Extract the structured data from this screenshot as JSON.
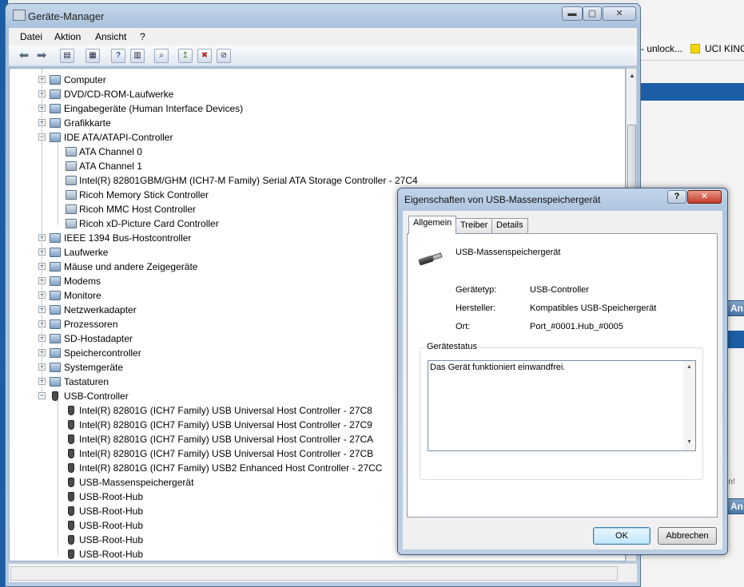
{
  "background": {
    "tab_left": "- unlock...",
    "tab_right": "UCI KINO",
    "btn_label": "An",
    "side_text": "en!"
  },
  "window": {
    "title": "Geräte-Manager",
    "minimize": "▬",
    "maximize": "▢",
    "close": "✕"
  },
  "menu": [
    "Datei",
    "Aktion",
    "Ansicht",
    "?"
  ],
  "tree": [
    {
      "label": "Computer",
      "level": 1,
      "exp": "+",
      "icon": "computer-icon"
    },
    {
      "label": "DVD/CD-ROM-Laufwerke",
      "level": 1,
      "exp": "+",
      "icon": "disc-drive-icon"
    },
    {
      "label": "Eingabegeräte (Human Interface Devices)",
      "level": 1,
      "exp": "+",
      "icon": "hid-icon"
    },
    {
      "label": "Grafikkarte",
      "level": 1,
      "exp": "+",
      "icon": "display-adapter-icon"
    },
    {
      "label": "IDE ATA/ATAPI-Controller",
      "level": 1,
      "exp": "−",
      "icon": "ide-controller-icon"
    },
    {
      "label": "ATA Channel 0",
      "level": 2,
      "icon": "ide-channel-icon"
    },
    {
      "label": "ATA Channel 1",
      "level": 2,
      "icon": "ide-channel-icon"
    },
    {
      "label": "Intel(R) 82801GBM/GHM (ICH7-M Family) Serial ATA Storage Controller - 27C4",
      "level": 2,
      "icon": "ide-channel-icon"
    },
    {
      "label": "Ricoh Memory Stick Controller",
      "level": 2,
      "icon": "ide-channel-icon"
    },
    {
      "label": "Ricoh MMC Host Controller",
      "level": 2,
      "icon": "ide-channel-icon"
    },
    {
      "label": "Ricoh xD-Picture Card Controller",
      "level": 2,
      "icon": "ide-channel-icon"
    },
    {
      "label": "IEEE 1394 Bus-Hostcontroller",
      "level": 1,
      "exp": "+",
      "icon": "ieee1394-icon"
    },
    {
      "label": "Laufwerke",
      "level": 1,
      "exp": "+",
      "icon": "disk-drive-icon"
    },
    {
      "label": "Mäuse und andere Zeigegeräte",
      "level": 1,
      "exp": "+",
      "icon": "mouse-icon"
    },
    {
      "label": "Modems",
      "level": 1,
      "exp": "+",
      "icon": "modem-icon"
    },
    {
      "label": "Monitore",
      "level": 1,
      "exp": "+",
      "icon": "monitor-icon"
    },
    {
      "label": "Netzwerkadapter",
      "level": 1,
      "exp": "+",
      "icon": "network-adapter-icon"
    },
    {
      "label": "Prozessoren",
      "level": 1,
      "exp": "+",
      "icon": "processor-icon"
    },
    {
      "label": "SD-Hostadapter",
      "level": 1,
      "exp": "+",
      "icon": "sd-host-icon"
    },
    {
      "label": "Speichercontroller",
      "level": 1,
      "exp": "+",
      "icon": "storage-controller-icon"
    },
    {
      "label": "Systemgeräte",
      "level": 1,
      "exp": "+",
      "icon": "system-device-icon"
    },
    {
      "label": "Tastaturen",
      "level": 1,
      "exp": "+",
      "icon": "keyboard-icon"
    },
    {
      "label": "USB-Controller",
      "level": 1,
      "exp": "−",
      "icon": "usb-icon"
    },
    {
      "label": "Intel(R) 82801G (ICH7 Family) USB Universal Host Controller - 27C8",
      "level": 2,
      "icon": "usb-icon"
    },
    {
      "label": "Intel(R) 82801G (ICH7 Family) USB Universal Host Controller - 27C9",
      "level": 2,
      "icon": "usb-icon"
    },
    {
      "label": "Intel(R) 82801G (ICH7 Family) USB Universal Host Controller - 27CA",
      "level": 2,
      "icon": "usb-icon"
    },
    {
      "label": "Intel(R) 82801G (ICH7 Family) USB Universal Host Controller - 27CB",
      "level": 2,
      "icon": "usb-icon"
    },
    {
      "label": "Intel(R) 82801G (ICH7 Family) USB2 Enhanced Host Controller - 27CC",
      "level": 2,
      "icon": "usb-icon"
    },
    {
      "label": "USB-Massenspeichergerät",
      "level": 2,
      "icon": "usb-icon"
    },
    {
      "label": "USB-Root-Hub",
      "level": 2,
      "icon": "usb-icon"
    },
    {
      "label": "USB-Root-Hub",
      "level": 2,
      "icon": "usb-icon"
    },
    {
      "label": "USB-Root-Hub",
      "level": 2,
      "icon": "usb-icon"
    },
    {
      "label": "USB-Root-Hub",
      "level": 2,
      "icon": "usb-icon"
    },
    {
      "label": "USB-Root-Hub",
      "level": 2,
      "icon": "usb-icon"
    }
  ],
  "dialog": {
    "title": "Eigenschaften von USB-Massenspeichergerät",
    "help": "?",
    "close": "✕",
    "tabs": [
      "Allgemein",
      "Treiber",
      "Details"
    ],
    "device_name": "USB-Massenspeichergerät",
    "props": [
      {
        "label": "Gerätetyp:",
        "value": "USB-Controller"
      },
      {
        "label": "Hersteller:",
        "value": "Kompatibles USB-Speichergerät"
      },
      {
        "label": "Ort:",
        "value": "Port_#0001.Hub_#0005"
      }
    ],
    "status_group": "Gerätestatus",
    "status_text": "Das Gerät funktioniert einwandfrei.",
    "ok": "OK",
    "cancel": "Abbrechen"
  }
}
